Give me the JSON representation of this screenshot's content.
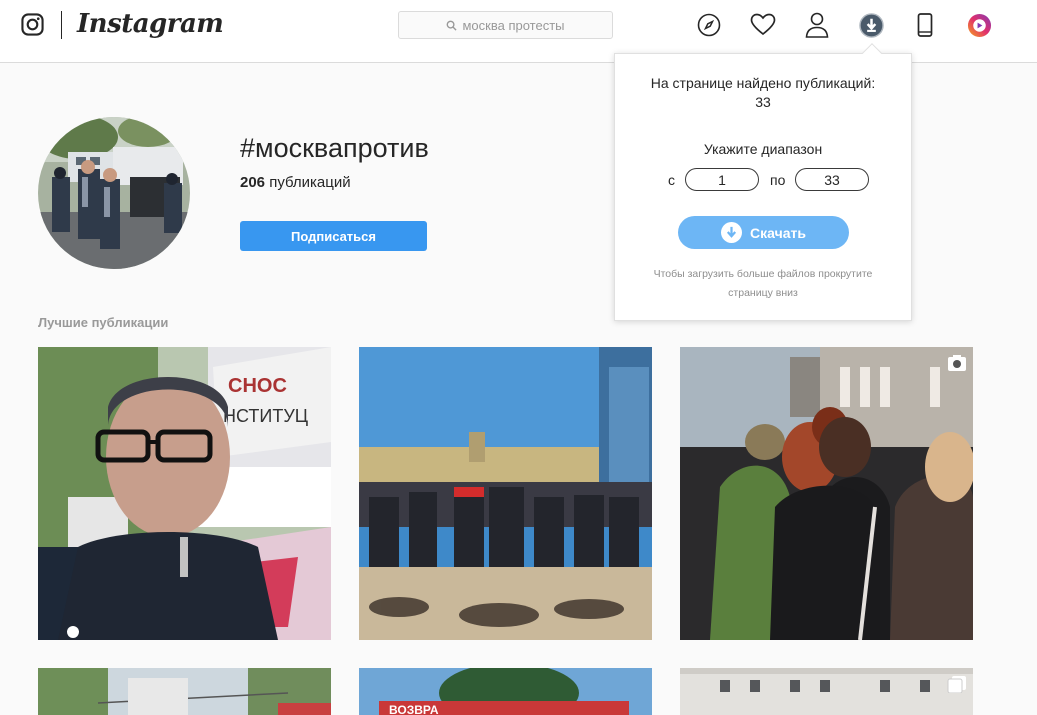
{
  "header": {
    "logo_text": "Instagram",
    "search_placeholder": "москва протесты",
    "icons": [
      "compass-icon",
      "heart-icon",
      "profile-icon",
      "download-extension-icon",
      "phone-icon",
      "video-extension-icon"
    ]
  },
  "profile": {
    "hashtag": "#москвапротив",
    "posts_number": "206",
    "posts_label": "публикаций",
    "follow_label": "Подписаться"
  },
  "section": {
    "top_posts_label": "Лучшие публикации"
  },
  "popup": {
    "found_label": "На странице найдено публикаций:",
    "found_count": "33",
    "range_label": "Укажите диапазон",
    "from_label": "с",
    "from_value": "1",
    "to_label": "по",
    "to_value": "33",
    "download_label": "Скачать",
    "hint": "Чтобы загрузить больше файлов прокрутите страницу вниз"
  },
  "colors": {
    "accent": "#3897f0",
    "download_button": "#6db6f5",
    "border": "#dbdbdb",
    "muted_text": "#999999"
  }
}
